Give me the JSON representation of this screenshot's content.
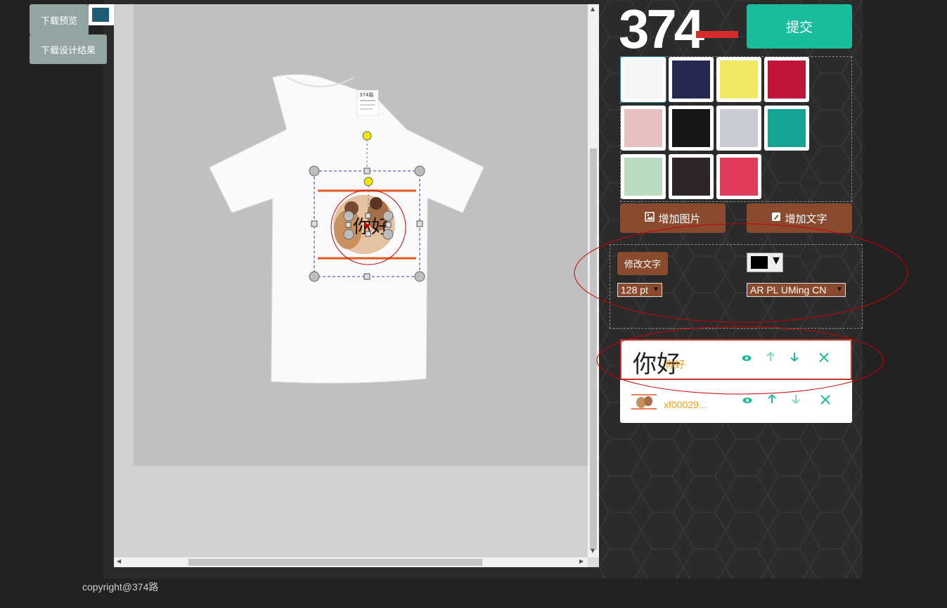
{
  "toolbar": {
    "download_preview": "下载预览",
    "download_result": "下载设计结果",
    "current_color": "#1d5d75"
  },
  "logo": {
    "text": "374"
  },
  "submit_label": "提交",
  "swatches": [
    {
      "color": "#f5f6f8",
      "selected": true
    },
    {
      "color": "#252850",
      "selected": false
    },
    {
      "color": "#f0e860",
      "selected": false
    },
    {
      "color": "#c0153a",
      "selected": false
    },
    {
      "color": "#e8c0c0",
      "selected": false
    },
    {
      "color": "#161616",
      "selected": false
    },
    {
      "color": "#c9ccd3",
      "selected": false
    },
    {
      "color": "#16a594",
      "selected": false
    },
    {
      "color": "#b9dcc0",
      "selected": false
    },
    {
      "color": "#2e2626",
      "selected": false
    },
    {
      "color": "#e23c5c",
      "selected": false
    }
  ],
  "buttons": {
    "add_image": "增加图片",
    "add_text": "增加文字",
    "edit_text": "修改文字"
  },
  "text_settings": {
    "color": "#000000",
    "size": "128 pt",
    "font": "AR PL UMing CN"
  },
  "canvas": {
    "design_text": "你好",
    "shirt_label": "374路"
  },
  "layers": [
    {
      "preview": "你好",
      "label": "你好",
      "icons": [
        "eye-icon",
        "arrow-up-icon",
        "arrow-down-icon",
        "close-icon"
      ]
    },
    {
      "preview": "image",
      "label": "xf00029...",
      "icons": [
        "eye-icon",
        "arrow-up-icon",
        "arrow-down-icon",
        "close-icon"
      ]
    }
  ],
  "footer": {
    "copyright": "copyright@374路"
  },
  "colors": {
    "accent": "#1abc9c",
    "brown": "#8a4a2e",
    "annotation_red": "#cc0000"
  }
}
